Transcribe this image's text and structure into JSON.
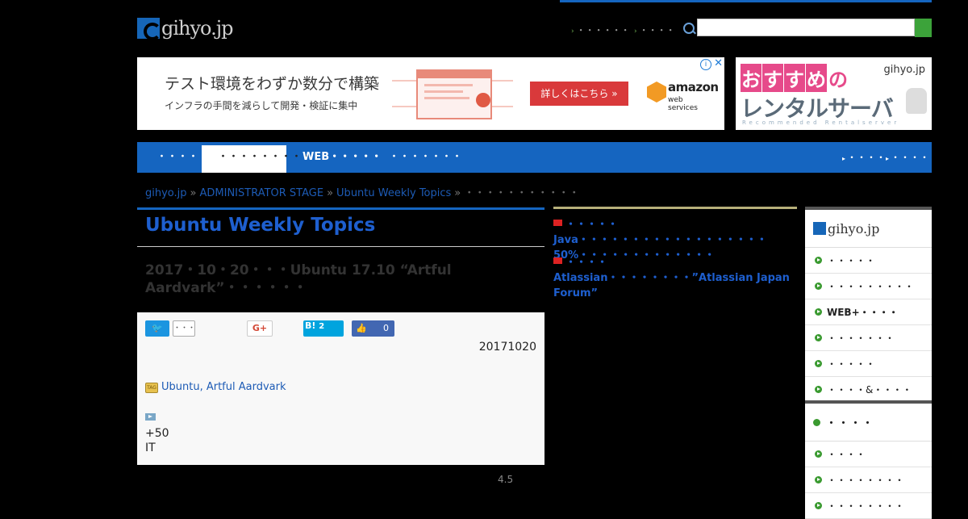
{
  "header": {
    "logo_text": "gihyo.jp",
    "top_links": [
      "・・・・・・",
      "・・・・"
    ],
    "search_placeholder": ""
  },
  "ads": {
    "main": {
      "headline": "テスト環境をわずか数分で構築",
      "subline": "インフラの手間を減らして開発・検証に集中",
      "button": "詳しくはこちら »",
      "brand_top": "amazon",
      "brand_bottom": "web services"
    },
    "side": {
      "line1": [
        "お",
        "す",
        "す",
        "め",
        "の"
      ],
      "line2": "レンタルサーバ",
      "line3": "Recommended Rentalserver",
      "brand": "gihyo.jp"
    }
  },
  "nav": {
    "tabs": [
      "・・・・・",
      "・・・・・・・・・・",
      "WEB・・・・・",
      "・・・・・・・"
    ],
    "right": [
      "・・・・",
      "・・・・"
    ]
  },
  "breadcrumb": {
    "items": [
      "gihyo.jp",
      "ADMINISTRATOR STAGE",
      "Ubuntu Weekly Topics"
    ],
    "current": "・・・・・・・・・・・"
  },
  "article": {
    "series_title": "Ubuntu Weekly Topics",
    "title": "2017・10・20・・・Ubuntu 17.10 “Artful Aardvark”・・・・・・",
    "social": {
      "tweet_count": "・・・",
      "gplus": "G+",
      "hatena": "B!",
      "hatena_count": "2",
      "fb_count": "0"
    },
    "date": "20171020",
    "tags": "Ubuntu, Artful Aardvark",
    "body_line1": "+50",
    "body_line2": "IT",
    "rating": "4.5"
  },
  "news": [
    "・・・・・Java・・・・・・・・・・・・・・・・・・50%・・・・・・・・・・・・・",
    "・・・・Atlassian・・・・・・・・”Atlassian Japan Forum”"
  ],
  "sidebar": {
    "box1": {
      "logo_text": "gihyo.jp",
      "items": [
        "・・・・・",
        "・・・・・・・・・",
        "WEB+・・・・",
        "・・・・・・・",
        "・・・・・",
        "・・・・&・・・・"
      ]
    },
    "box2": {
      "title": "・・・・",
      "items": [
        "・・・・",
        "・・・・・・・・",
        "・・・・・・・・"
      ]
    }
  },
  "colors": {
    "accent_blue": "#1565c0",
    "link_blue": "#1d5bb5",
    "green": "#3ca33a"
  }
}
